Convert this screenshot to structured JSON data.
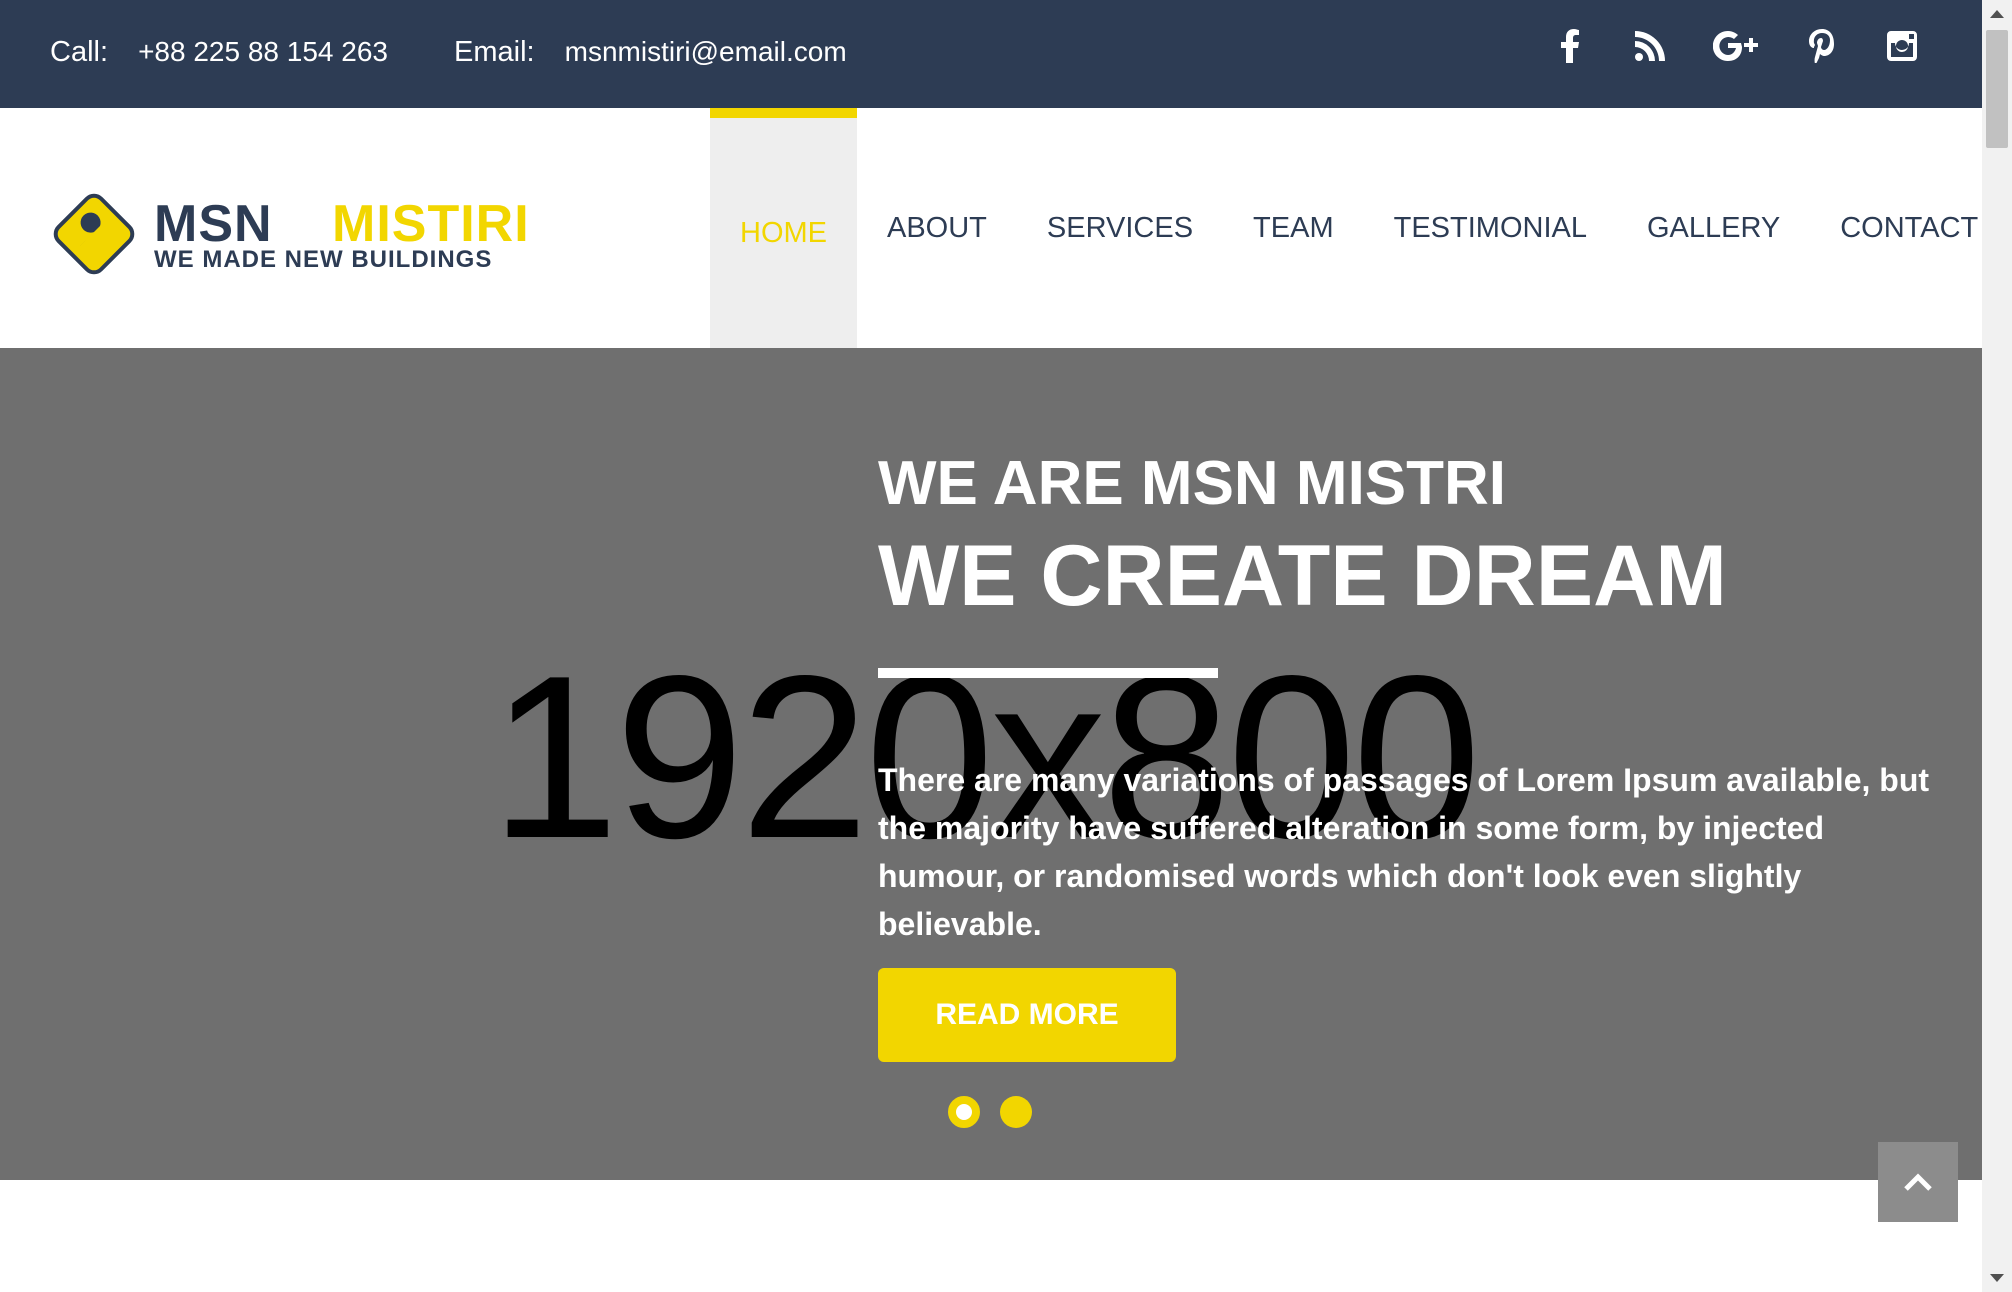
{
  "topbar": {
    "call_label": "Call:",
    "call_value": "+88 225 88 154 263",
    "email_label": "Email:",
    "email_value": "msnmistiri@email.com",
    "socials": [
      "facebook-icon",
      "rss-icon",
      "google-plus-icon",
      "pinterest-icon",
      "instagram-icon"
    ]
  },
  "brand": {
    "name_primary": "MSN",
    "name_secondary": "MISTIRI",
    "tagline": "WE MADE NEW BUILDINGS"
  },
  "nav": {
    "items": [
      {
        "label": "HOME",
        "active": true
      },
      {
        "label": "ABOUT"
      },
      {
        "label": "SERVICES"
      },
      {
        "label": "TEAM"
      },
      {
        "label": "TESTIMONIAL"
      },
      {
        "label": "GALLERY"
      },
      {
        "label": "CONTACT"
      }
    ]
  },
  "hero": {
    "placeholder": "1920x800",
    "subtitle": "WE ARE MSN MISTRI",
    "title": "WE CREATE DREAM",
    "text": "There are many variations of passages of Lorem Ipsum available, but the majority have suffered alteration in some form, by injected humour, or randomised words which don't look even slightly believable.",
    "button": "READ MORE",
    "slides": 2,
    "active_slide": 1
  },
  "colors": {
    "accent": "#f2d600",
    "dark": "#2d3c54",
    "hero_bg": "#6f6f6f"
  }
}
